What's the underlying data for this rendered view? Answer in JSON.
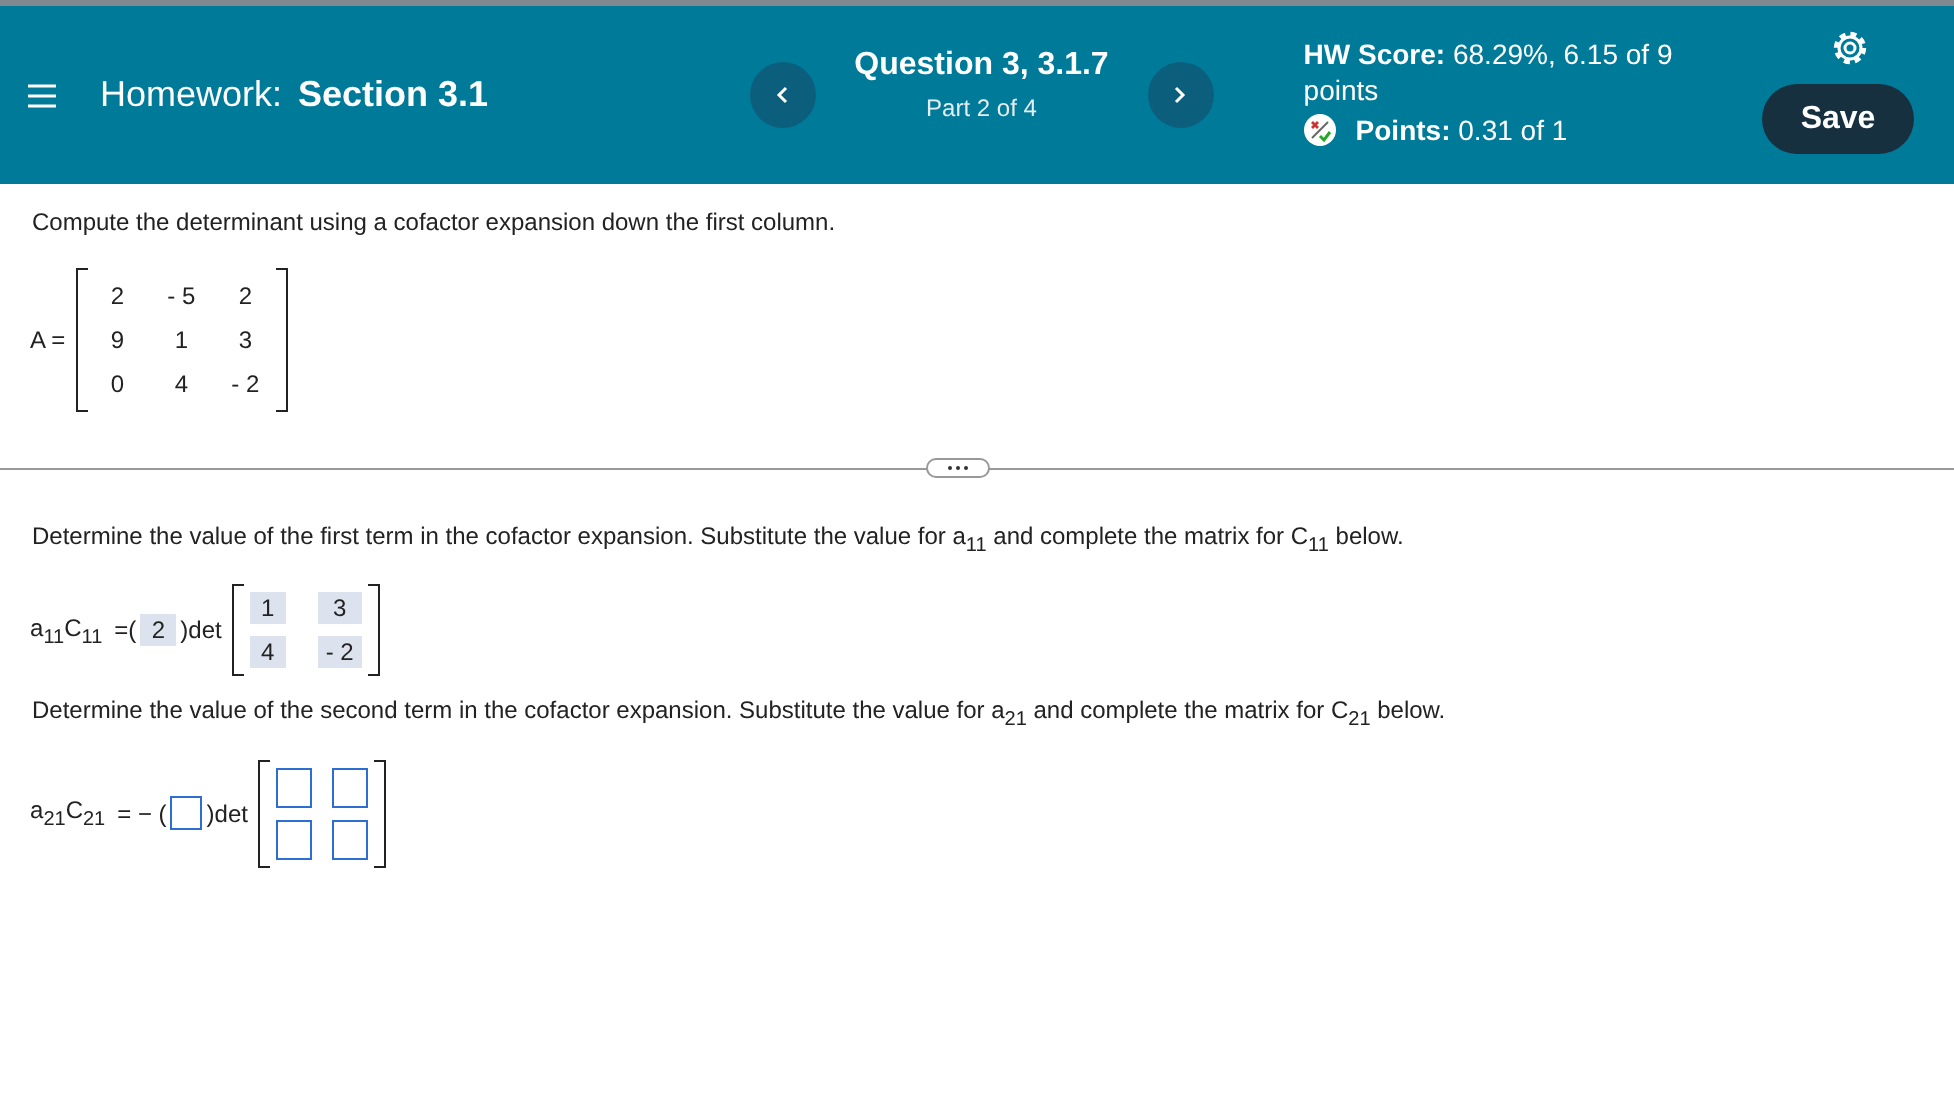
{
  "header": {
    "title_label": "Homework:",
    "title": "Section 3.1",
    "question": "Question 3, 3.1.7",
    "part": "Part 2 of 4",
    "hw_score": "**HW Score:** 68.29%, 6.15 of 9 points",
    "points": "**Points:** 0.31 of 1",
    "save": "Save"
  },
  "instruction": "Compute the determinant using a cofactor expansion down the first column.",
  "matrix": {
    "label": "A =",
    "rows": [
      [
        "2",
        "- 5",
        "2"
      ],
      [
        "9",
        "1",
        "3"
      ],
      [
        "0",
        "4",
        "- 2"
      ]
    ]
  },
  "steps": [
    {
      "prompt": "Determine the value of the first term in the cofactor expansion. Substitute the value for a$_{11}$ and complete the matrix for C$_{11}$ below.",
      "lhs": "a$_{11}$C$_{11}$",
      "op": "=(",
      "close": ")det",
      "coef": {
        "kind": "answered",
        "value": "2"
      },
      "cells": [
        [
          {
            "kind": "answered",
            "value": "1"
          },
          {
            "kind": "answered",
            "value": "3"
          }
        ],
        [
          {
            "kind": "answered",
            "value": "4"
          },
          {
            "kind": "answered",
            "value": "- 2"
          }
        ]
      ]
    },
    {
      "prompt": "Determine the value of the second term in the cofactor expansion. Substitute the value for a$_{21}$ and complete the matrix for C$_{21}$ below.",
      "lhs": "a$_{21}$C$_{21}$",
      "op": "= − (",
      "close": ")det",
      "coef": {
        "kind": "blank"
      },
      "cells": [
        [
          {
            "kind": "blank"
          },
          {
            "kind": "blank"
          }
        ],
        [
          {
            "kind": "blank"
          },
          {
            "kind": "blank"
          }
        ]
      ]
    }
  ]
}
